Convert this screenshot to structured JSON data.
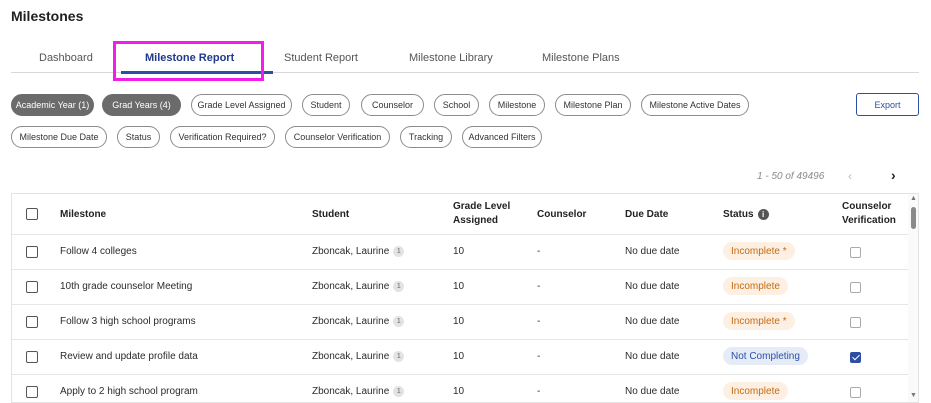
{
  "page": {
    "title": "Milestones"
  },
  "tabs": [
    "Dashboard",
    "Milestone Report",
    "Student Report",
    "Milestone Library",
    "Milestone Plans"
  ],
  "filters_row1": [
    {
      "label": "Academic Year (1)",
      "selected": true
    },
    {
      "label": "Grad Years (4)",
      "selected": true
    },
    {
      "label": "Grade Level Assigned",
      "selected": false
    },
    {
      "label": "Student",
      "selected": false
    },
    {
      "label": "Counselor",
      "selected": false
    },
    {
      "label": "School",
      "selected": false
    },
    {
      "label": "Milestone",
      "selected": false
    },
    {
      "label": "Milestone Plan",
      "selected": false
    },
    {
      "label": "Milestone Active Dates",
      "selected": false
    }
  ],
  "filters_row2": [
    {
      "label": "Milestone Due Date"
    },
    {
      "label": "Status"
    },
    {
      "label": "Verification Required?"
    },
    {
      "label": "Counselor Verification"
    },
    {
      "label": "Tracking"
    },
    {
      "label": "Advanced Filters"
    }
  ],
  "toolbar": {
    "export_label": "Export"
  },
  "pager": {
    "range": "1 - 50 of 49496",
    "prev": "‹",
    "next": "›"
  },
  "table": {
    "headers": {
      "milestone": "Milestone",
      "student": "Student",
      "grade_line1": "Grade Level",
      "grade_line2": "Assigned",
      "counselor": "Counselor",
      "due_date": "Due Date",
      "status": "Status",
      "cv_line1": "Counselor",
      "cv_line2": "Verification"
    },
    "rows": [
      {
        "milestone": "Follow 4 colleges",
        "student": "Zboncak, Laurine",
        "student_badge": "1",
        "grade": "10",
        "counselor": "-",
        "due": "No due date",
        "status": "Incomplete *",
        "status_type": "incomplete",
        "verified": false
      },
      {
        "milestone": "10th grade counselor Meeting",
        "student": "Zboncak, Laurine",
        "student_badge": "1",
        "grade": "10",
        "counselor": "-",
        "due": "No due date",
        "status": "Incomplete",
        "status_type": "incomplete",
        "verified": false
      },
      {
        "milestone": "Follow 3 high school programs",
        "student": "Zboncak, Laurine",
        "student_badge": "1",
        "grade": "10",
        "counselor": "-",
        "due": "No due date",
        "status": "Incomplete *",
        "status_type": "incomplete",
        "verified": false
      },
      {
        "milestone": "Review and update profile data",
        "student": "Zboncak, Laurine",
        "student_badge": "1",
        "grade": "10",
        "counselor": "-",
        "due": "No due date",
        "status": "Not Completing",
        "status_type": "notcompleting",
        "verified": true
      },
      {
        "milestone": "Apply to 2 high school program",
        "student": "Zboncak, Laurine",
        "student_badge": "1",
        "grade": "10",
        "counselor": "-",
        "due": "No due date",
        "status": "Incomplete",
        "status_type": "incomplete",
        "verified": false
      }
    ]
  },
  "icons": {
    "info": "info-icon",
    "chevron_left": "chevron-left-icon",
    "chevron_right": "chevron-right-icon"
  },
  "colors": {
    "accent": "#2c4fa3",
    "highlight": "#f01ee8",
    "incomplete": "#c46a12",
    "chip_selected": "#6b6b6b"
  }
}
